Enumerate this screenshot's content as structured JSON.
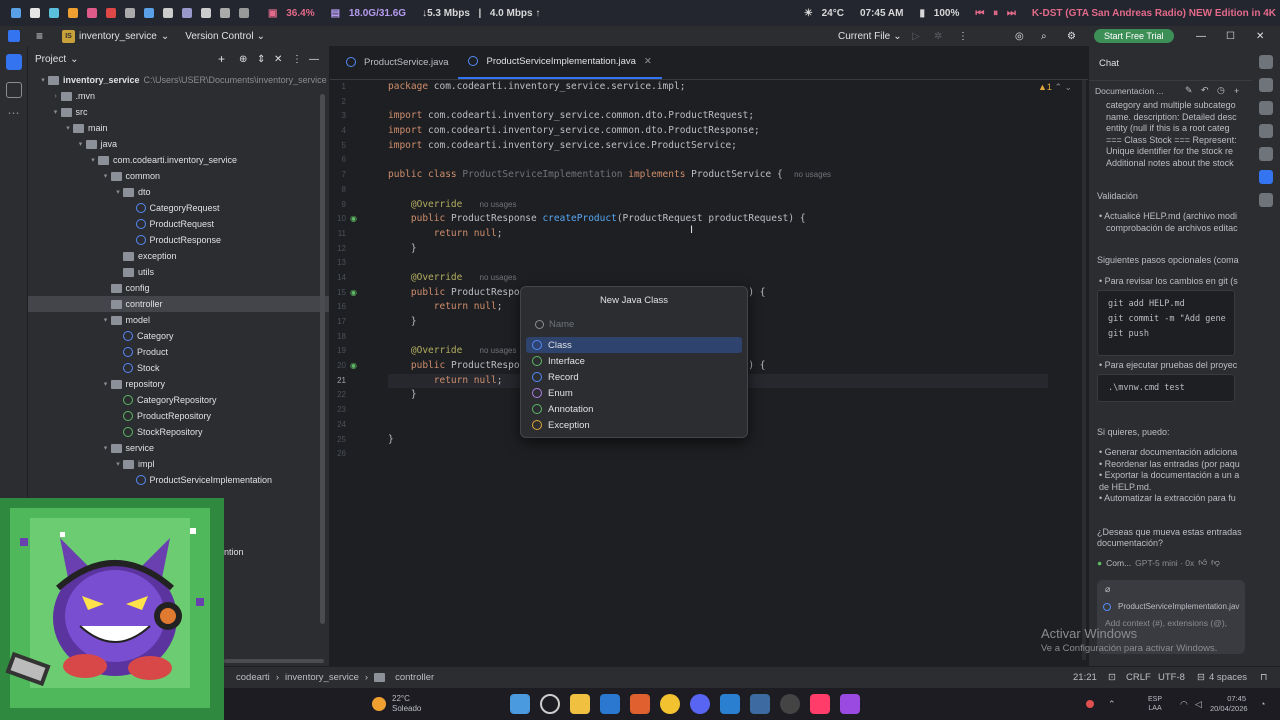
{
  "status": {
    "cpu": "36.4%",
    "ram": "18.0G/31.6G",
    "net_down": "↓5.3 Mbps",
    "net_up": "4.0 Mbps ↑",
    "temp": "24°C",
    "time": "07:45 AM",
    "battery": "100%",
    "media": "K-DST (GTA San Andreas Radio) NEW Edition in 4K"
  },
  "titlebar": {
    "project_badge": "IS",
    "project": "inventory_service",
    "vcs": "Version Control",
    "run_config": "Current File",
    "trial": "Start Free Trial"
  },
  "project": {
    "title": "Project",
    "tree": [
      {
        "indent": 0,
        "tri": "▾",
        "kind": "folder",
        "label": "inventory_service",
        "muted": "C:\\Users\\USER\\Documents\\inventory_service",
        "bold": true
      },
      {
        "indent": 1,
        "tri": "›",
        "kind": "folder",
        "label": ".mvn"
      },
      {
        "indent": 1,
        "tri": "▾",
        "kind": "folder",
        "label": "src"
      },
      {
        "indent": 2,
        "tri": "▾",
        "kind": "folder",
        "label": "main"
      },
      {
        "indent": 3,
        "tri": "▾",
        "kind": "folder",
        "label": "java"
      },
      {
        "indent": 4,
        "tri": "▾",
        "kind": "folder",
        "label": "com.codearti.inventory_service"
      },
      {
        "indent": 5,
        "tri": "▾",
        "kind": "folder",
        "label": "common"
      },
      {
        "indent": 6,
        "tri": "▾",
        "kind": "folder",
        "label": "dto"
      },
      {
        "indent": 7,
        "tri": "",
        "kind": "class",
        "label": "CategoryRequest"
      },
      {
        "indent": 7,
        "tri": "",
        "kind": "class",
        "label": "ProductRequest"
      },
      {
        "indent": 7,
        "tri": "",
        "kind": "class",
        "label": "ProductResponse"
      },
      {
        "indent": 6,
        "tri": "",
        "kind": "folder",
        "label": "exception"
      },
      {
        "indent": 6,
        "tri": "",
        "kind": "folder",
        "label": "utils"
      },
      {
        "indent": 5,
        "tri": "",
        "kind": "folder",
        "label": "config"
      },
      {
        "indent": 5,
        "tri": "",
        "kind": "folder",
        "label": "controller",
        "selected": true
      },
      {
        "indent": 5,
        "tri": "▾",
        "kind": "folder",
        "label": "model"
      },
      {
        "indent": 6,
        "tri": "",
        "kind": "class",
        "label": "Category"
      },
      {
        "indent": 6,
        "tri": "",
        "kind": "class",
        "label": "Product"
      },
      {
        "indent": 6,
        "tri": "",
        "kind": "class",
        "label": "Stock"
      },
      {
        "indent": 5,
        "tri": "▾",
        "kind": "folder",
        "label": "repository"
      },
      {
        "indent": 6,
        "tri": "",
        "kind": "iface",
        "label": "CategoryRepository"
      },
      {
        "indent": 6,
        "tri": "",
        "kind": "iface",
        "label": "ProductRepository"
      },
      {
        "indent": 6,
        "tri": "",
        "kind": "iface",
        "label": "StockRepository"
      },
      {
        "indent": 5,
        "tri": "▾",
        "kind": "folder",
        "label": "service"
      },
      {
        "indent": 6,
        "tri": "▾",
        "kind": "folder",
        "label": "impl"
      },
      {
        "indent": 7,
        "tri": "",
        "kind": "class",
        "label": "ProductServiceImplementation"
      }
    ],
    "partial_text": "ntion"
  },
  "editor": {
    "tabs": [
      {
        "label": "ProductService.java",
        "active": false
      },
      {
        "label": "ProductServiceImplementation.java",
        "active": true
      }
    ],
    "warnings": "▲1",
    "current_line": 21,
    "lines": [
      [
        {
          "t": "kw",
          "v": "package "
        },
        {
          "t": "",
          "v": "com.codearti.inventory_service.service.impl;"
        }
      ],
      [],
      [
        {
          "t": "kw",
          "v": "import "
        },
        {
          "t": "",
          "v": "com.codearti.inventory_service.common.dto.ProductRequest;"
        }
      ],
      [
        {
          "t": "kw",
          "v": "import "
        },
        {
          "t": "",
          "v": "com.codearti.inventory_service.common.dto.ProductResponse;"
        }
      ],
      [
        {
          "t": "kw",
          "v": "import "
        },
        {
          "t": "",
          "v": "com.codearti.inventory_service.service.ProductService;"
        }
      ],
      [],
      [
        {
          "t": "kw",
          "v": "public class "
        },
        {
          "t": "dim",
          "v": "ProductServiceImplementation "
        },
        {
          "t": "kw",
          "v": "implements "
        },
        {
          "t": "",
          "v": "ProductService {  "
        },
        {
          "t": "hint",
          "v": "no usages"
        }
      ],
      [],
      [
        {
          "t": "",
          "v": "    "
        },
        {
          "t": "an",
          "v": "@Override"
        },
        {
          "t": "",
          "v": "   "
        },
        {
          "t": "hint",
          "v": "no usages"
        }
      ],
      [
        {
          "t": "",
          "v": "    "
        },
        {
          "t": "kw",
          "v": "public "
        },
        {
          "t": "",
          "v": "ProductResponse "
        },
        {
          "t": "fn",
          "v": "createProduct"
        },
        {
          "t": "",
          "v": "(ProductRequest productRequest) {"
        }
      ],
      [
        {
          "t": "",
          "v": "        "
        },
        {
          "t": "kw",
          "v": "return null"
        },
        {
          "t": "",
          "v": ";"
        }
      ],
      [
        {
          "t": "",
          "v": "    }"
        }
      ],
      [],
      [
        {
          "t": "",
          "v": "    "
        },
        {
          "t": "an",
          "v": "@Override"
        },
        {
          "t": "",
          "v": "   "
        },
        {
          "t": "hint",
          "v": "no usages"
        }
      ],
      [
        {
          "t": "",
          "v": "    "
        },
        {
          "t": "kw",
          "v": "public "
        },
        {
          "t": "",
          "v": "ProductRespons                                   est) {"
        }
      ],
      [
        {
          "t": "",
          "v": "        "
        },
        {
          "t": "kw",
          "v": "return null"
        },
        {
          "t": "",
          "v": ";"
        }
      ],
      [
        {
          "t": "",
          "v": "    }"
        }
      ],
      [],
      [
        {
          "t": "",
          "v": "    "
        },
        {
          "t": "an",
          "v": "@Override"
        },
        {
          "t": "",
          "v": "   "
        },
        {
          "t": "hint",
          "v": "no usages"
        }
      ],
      [
        {
          "t": "",
          "v": "    "
        },
        {
          "t": "kw",
          "v": "public "
        },
        {
          "t": "",
          "v": "ProductRespons                                   est) {"
        }
      ],
      [
        {
          "t": "",
          "v": "        "
        },
        {
          "t": "kw",
          "v": "return null"
        },
        {
          "t": "",
          "v": ";"
        }
      ],
      [
        {
          "t": "",
          "v": "    }"
        }
      ],
      [],
      [],
      [
        {
          "t": "",
          "v": "}"
        }
      ],
      []
    ]
  },
  "popup": {
    "title": "New Java Class",
    "placeholder": "Name",
    "options": [
      {
        "label": "Class",
        "selected": true,
        "color": "#548af7"
      },
      {
        "label": "Interface",
        "selected": false,
        "color": "#5fb865"
      },
      {
        "label": "Record",
        "selected": false,
        "color": "#548af7"
      },
      {
        "label": "Enum",
        "selected": false,
        "color": "#b07ee8"
      },
      {
        "label": "Annotation",
        "selected": false,
        "color": "#5fb865"
      },
      {
        "label": "Exception",
        "selected": false,
        "color": "#e0a93a"
      }
    ]
  },
  "chat": {
    "title": "Chat",
    "doc_title": "Documentacion ...",
    "intro_lines": [
      "category and multiple subcatego",
      "name. description: Detailed desc",
      "entity (null if this is a root categ",
      "=== Class Stock === Represent:",
      "Unique identifier for the stock re",
      "Additional notes about the stock"
    ],
    "validacion": "Validación",
    "validacion_line1": "• Actualicé HELP.md (archivo modi",
    "validacion_line2": "comprobación de archivos editac",
    "siguientes": "Siguientes pasos opcionales (coma",
    "git_bullet": "• Para revisar los cambios en git (s",
    "git_cmds": [
      "git add HELP.md",
      "git commit -m \"Add gene",
      "git push"
    ],
    "test_bullet": "• Para ejecutar pruebas del proyec",
    "test_cmd": ".\\mvnw.cmd test",
    "si_quieres": "Si quieres, puedo:",
    "puedo_items": [
      "• Generar documentación adiciona",
      "• Reordenar las entradas (por paqu",
      "• Exportar la documentación a un a",
      "  de HELP.md.",
      "• Automatizar la extracción para fu"
    ],
    "question1": "¿Deseas que mueva estas entradas",
    "question2": "documentación?",
    "model_label": "Com...",
    "model": "GPT-5 mini · 0x",
    "attached_file": "ProductServiceImplementation.jav",
    "input_placeholder": "Add context (#), extensions (@),"
  },
  "watermark": {
    "line1": "Activar Windows",
    "line2": "Ve a Configuración para activar Windows."
  },
  "bottom": {
    "breadcrumb": [
      "codearti",
      "inventory_service",
      "controller"
    ],
    "position": "21:21",
    "line_sep": "CRLF",
    "encoding": "UTF-8",
    "indent": "4 spaces"
  },
  "taskbar": {
    "weather_temp": "22°C",
    "weather_desc": "Soleado",
    "lang": "ESP",
    "lang2": "LAA",
    "clock_time": "07:45",
    "clock_date": "20/04/2026"
  },
  "colors": {
    "accent": "#3574f0",
    "trial_green": "#3d8f58",
    "selection": "#2e436e"
  }
}
